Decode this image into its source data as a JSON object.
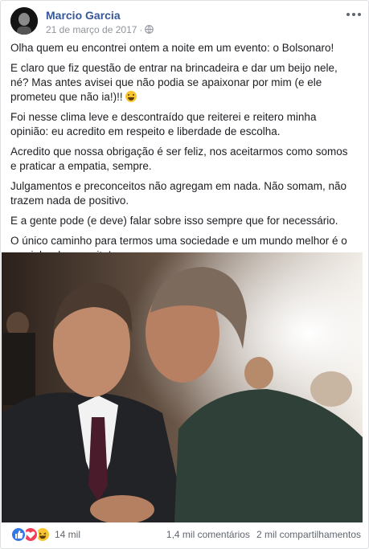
{
  "post": {
    "author": "Marcio Garcia",
    "date": "21 de março de 2017",
    "separator": "·",
    "paragraphs": {
      "p1": "Olha quem eu encontrei ontem a noite em um evento: o Bolsonaro!",
      "p2": "E claro que fiz questão de entrar na brincadeira e dar um beijo nele, né? Mas antes avisei que não podia se apaixonar por mim (e ele prometeu que não ia!)!!",
      "p3": "Foi nesse clima leve e descontraído que reiterei e reitero minha opinião: eu acredito em respeito e liberdade de escolha.",
      "p4": "Acredito que nossa obrigação é ser feliz, nos aceitarmos como somos e praticar a empatia, sempre.",
      "p5": "Julgamentos e preconceitos não agregam em nada. Não somam, não trazem nada de positivo.",
      "p6": "E a gente pode (e deve) falar sobre isso sempre que for necessário.",
      "p7": "O único caminho para termos uma sociedade e um mundo melhor é o caminho do respeito!"
    }
  },
  "footer": {
    "reactions_count": "14 mil",
    "comments": "1,4 mil comentários",
    "shares": "2 mil compartilhamentos"
  },
  "icons": [
    "globe-icon",
    "more-options-icon",
    "like-reaction-icon",
    "love-reaction-icon",
    "haha-reaction-icon",
    "grinning-emoji-icon"
  ],
  "colors": {
    "author_link": "#365899",
    "meta_gray": "#90949c",
    "like_blue": "#3578e5",
    "love_red": "#f33e58",
    "haha_yellow": "#f7c531"
  }
}
